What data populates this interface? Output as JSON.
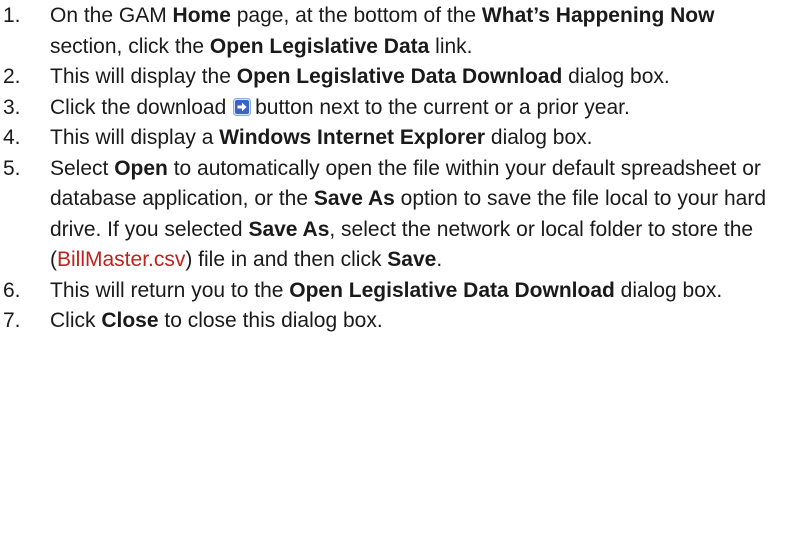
{
  "colors": {
    "text": "#1a1a1a",
    "filename": "#c0201e",
    "icon_fill": "#3b62c7",
    "icon_border": "#8fa8e0"
  },
  "steps": [
    {
      "num": "1.",
      "parts": [
        "On the GAM ",
        "Home",
        " page, at the bottom of the ",
        "What’s Happening Now",
        " section, click the ",
        "Open Legislative Data",
        " link."
      ]
    },
    {
      "num": "2.",
      "parts": [
        "This will display the ",
        "Open Legislative Data Download",
        " dialog box."
      ]
    },
    {
      "num": "3.",
      "parts": [
        "Click the download ",
        "button next to the current or a prior year."
      ],
      "icon": "right-arrow-download-icon"
    },
    {
      "num": "4.",
      "parts": [
        "This will display a ",
        "Windows Internet Explorer",
        " dialog box."
      ]
    },
    {
      "num": "5.",
      "parts": [
        "Select ",
        "Open",
        " to automatically open the file within your default spreadsheet or database application, or the ",
        "Save As",
        " option to save the file local to your hard drive. If you selected ",
        "Save As",
        ", select the network or local folder to store the (",
        "BillMaster.csv",
        ") file in and then click ",
        "Save",
        "."
      ]
    },
    {
      "num": "6.",
      "parts": [
        "This will return you to the ",
        "Open Legislative Data Download",
        " dialog box."
      ]
    },
    {
      "num": "7.",
      "parts": [
        "Click ",
        "Close",
        " to close this dialog box."
      ]
    }
  ]
}
